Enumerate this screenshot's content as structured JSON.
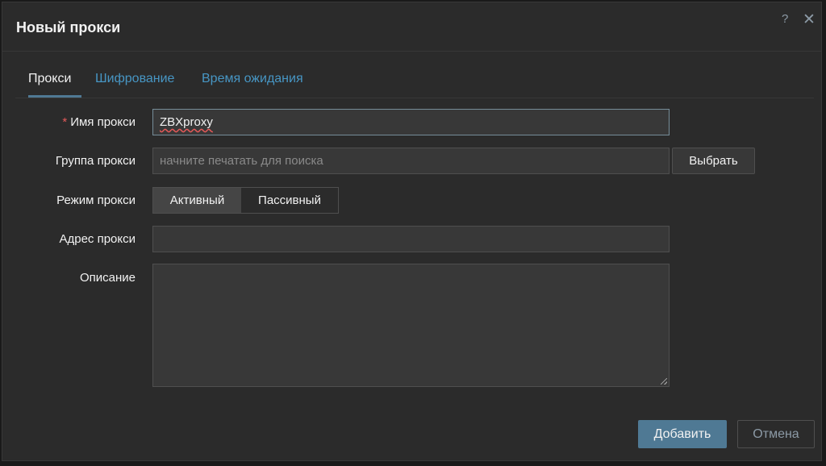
{
  "dialog": {
    "title": "Новый прокси",
    "help_icon": "?",
    "close_icon": "✕"
  },
  "tabs": [
    {
      "label": "Прокси",
      "active": true
    },
    {
      "label": "Шифрование",
      "active": false
    },
    {
      "label": "Время ожидания",
      "active": false
    }
  ],
  "form": {
    "name": {
      "label": "Имя прокси",
      "required_mark": "*",
      "value": "ZBXproxy"
    },
    "group": {
      "label": "Группа прокси",
      "placeholder": "начните печатать для поиска",
      "value": "",
      "select_button": "Выбрать"
    },
    "mode": {
      "label": "Режим прокси",
      "options": [
        "Активный",
        "Пассивный"
      ],
      "selected": "Активный"
    },
    "address": {
      "label": "Адрес прокси",
      "value": ""
    },
    "description": {
      "label": "Описание",
      "value": ""
    }
  },
  "footer": {
    "add_button": "Добавить",
    "cancel_button": "Отмена"
  },
  "colors": {
    "background": "#2b2b2b",
    "accent": "#4f7994",
    "link": "#4796c4",
    "required": "#e45959"
  }
}
